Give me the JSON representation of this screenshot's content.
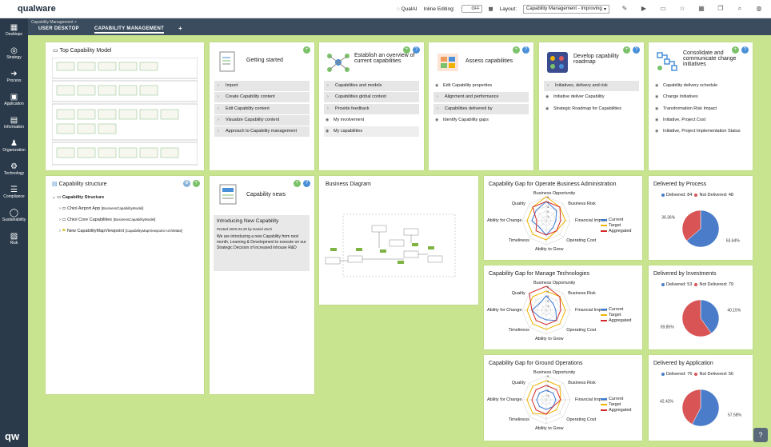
{
  "app": {
    "logo": "qualware"
  },
  "topbar": {
    "qualai": "QualAI",
    "inline_editing_label": "Inline Editing:",
    "toggle_state": "OFF",
    "layout_label": "Layout:",
    "layout_value": "Capability Management - Improving"
  },
  "sidebar": {
    "items": [
      {
        "label": "Desktops",
        "icon": "▦"
      },
      {
        "label": "Strategy",
        "icon": "◎"
      },
      {
        "label": "Process",
        "icon": "➜"
      },
      {
        "label": "Application",
        "icon": "▣"
      },
      {
        "label": "Information",
        "icon": "▤"
      },
      {
        "label": "Organization",
        "icon": "♟"
      },
      {
        "label": "Technology",
        "icon": "⚙"
      },
      {
        "label": "Compliance",
        "icon": "☰"
      },
      {
        "label": "Sustainability",
        "icon": "◯"
      },
      {
        "label": "Risk",
        "icon": "▨"
      }
    ]
  },
  "tabs": {
    "breadcrumb": "Capability Management  >",
    "user_desktop": "USER DESKTOP",
    "capability_management": "CAPABILITY MANAGEMENT",
    "add": "+"
  },
  "cards": {
    "top_capability_model": {
      "title": "Top Capability Model"
    },
    "getting_started": {
      "title": "Getting started",
      "items": [
        "Import",
        "Create Capability content",
        "Edit Capability content",
        "Visualize Capability content",
        "Approach to Capability management"
      ]
    },
    "overview": {
      "title": "Establish an overview of current capabilities",
      "grey_items": [
        "Capabilities and models",
        "Capabilities global context",
        "Provide feedback"
      ],
      "eye_items": [
        "My involvement",
        "My capabilities"
      ]
    },
    "assess": {
      "title": "Assess capabilities",
      "items": [
        "Edit Capability properties",
        "Alignment and performance",
        "Capabilities delivered by",
        "Identify Capability gaps"
      ]
    },
    "roadmap": {
      "title": "Develop capability roadmap",
      "items": [
        "Initiatives, delivery and risk",
        "Initiative deliver Capability",
        "Strategic Roadmap for Capabilities"
      ]
    },
    "consolidate": {
      "title": "Consolidate and communicate change initiatives",
      "items": [
        "Capability delivery schedule",
        "Change Initiatives",
        "Transformation Risk Impact",
        "Initiative, Project Cost",
        "Initiative, Project Implementation Status"
      ]
    },
    "structure": {
      "title": "Capability structure",
      "root": "Capability Structure",
      "children": [
        {
          "name": "Chiol Airport App",
          "type": "[BusinessCapabilityModel]"
        },
        {
          "name": "Chiol Core Capabilities",
          "type": "[BusinessCapabilityModel]"
        },
        {
          "name": "New CapabilityMapViewpoint",
          "type": "[CapabilityMapViewpoint ArchiMate]"
        }
      ]
    },
    "news": {
      "title": "Capability news",
      "headline": "Introducing New Capability",
      "meta": "Posted 2025.03.28 by Daniel Zorzi",
      "body": "We are introducing a new Capability from next month, Learning & Development to execute on our Strategic Decision of increased inhouse R&D"
    },
    "business_diagram": {
      "title": "Business Diagram"
    }
  },
  "radar_axes": [
    "Business Opportunity",
    "Business Risk",
    "Financial Impact",
    "Operating Cost",
    "Ability to Grow",
    "Timeliness",
    "Ability for Change",
    "Quality"
  ],
  "radar_legend": [
    "Current",
    "Target",
    "Aggregated"
  ],
  "colors": {
    "current": "#3a7bd5",
    "target": "#f0b400",
    "aggregated": "#d42a2a",
    "delivered": "#4a7cc9",
    "not_delivered": "#d95454",
    "background": "#c8e48f"
  },
  "chart_data": [
    {
      "type": "radar",
      "title": "Capability Gap for Operate Business Administration",
      "categories": [
        "Business Opportunity",
        "Business Risk",
        "Financial Impact",
        "Operating Cost",
        "Ability to Grow",
        "Timeliness",
        "Ability for Change",
        "Quality"
      ],
      "scale": [
        1,
        5
      ],
      "series": [
        {
          "name": "Current",
          "values": [
            4,
            3,
            2,
            2,
            3,
            2,
            3,
            3
          ]
        },
        {
          "name": "Target",
          "values": [
            5,
            4,
            4,
            3,
            4,
            4,
            4,
            4
          ]
        },
        {
          "name": "Aggregated",
          "values": [
            4,
            4,
            3,
            3,
            3,
            3,
            2,
            4
          ]
        }
      ]
    },
    {
      "type": "radar",
      "title": "Capability Gap for Manage Technologies",
      "categories": [
        "Business Opportunity",
        "Business Risk",
        "Financial Impact",
        "Operating Cost",
        "Ability to Grow",
        "Timeliness",
        "Ability for Change",
        "Quality"
      ],
      "scale": [
        1,
        5
      ],
      "series": [
        {
          "name": "Current",
          "values": [
            3,
            2,
            2,
            3,
            2,
            2,
            3,
            2
          ]
        },
        {
          "name": "Target",
          "values": [
            4,
            4,
            4,
            4,
            4,
            4,
            4,
            4
          ]
        },
        {
          "name": "Aggregated",
          "values": [
            5,
            4,
            3,
            3,
            3,
            3,
            3,
            5
          ]
        }
      ]
    },
    {
      "type": "radar",
      "title": "Capability Gap for Ground Operations",
      "categories": [
        "Business Opportunity",
        "Business Risk",
        "Financial Impact",
        "Operating Cost",
        "Ability to Grow",
        "Timeliness",
        "Ability for Change",
        "Quality"
      ],
      "scale": [
        1,
        5
      ],
      "series": [
        {
          "name": "Current",
          "values": [
            2,
            2,
            2,
            2,
            2,
            2,
            2,
            2
          ]
        },
        {
          "name": "Target",
          "values": [
            4,
            4,
            3,
            3,
            3,
            4,
            4,
            4
          ]
        },
        {
          "name": "Aggregated",
          "values": [
            3,
            3,
            3,
            2,
            3,
            3,
            3,
            3
          ]
        }
      ]
    },
    {
      "type": "pie",
      "title": "Delivered by Process",
      "series": [
        {
          "name": "Delivered",
          "value": 84,
          "label": "63.64%"
        },
        {
          "name": "Not Delivered",
          "value": 48,
          "label": "36.36%"
        }
      ],
      "legend": [
        "Delivered: 84",
        "Not Delivered: 48"
      ]
    },
    {
      "type": "pie",
      "title": "Delivered by Investments",
      "series": [
        {
          "name": "Delivered",
          "value": 53,
          "label": "40.15%"
        },
        {
          "name": "Not Delivered",
          "value": 79,
          "label": "59.85%"
        }
      ],
      "legend": [
        "Delivered: 53",
        "Not Delivered: 79"
      ]
    },
    {
      "type": "pie",
      "title": "Delivered by Application",
      "series": [
        {
          "name": "Delivered",
          "value": 76,
          "label": "57.58%"
        },
        {
          "name": "Not Delivered",
          "value": 56,
          "label": "42.42%"
        }
      ],
      "legend": [
        "Delivered: 76",
        "Not Delivered: 56"
      ]
    }
  ]
}
